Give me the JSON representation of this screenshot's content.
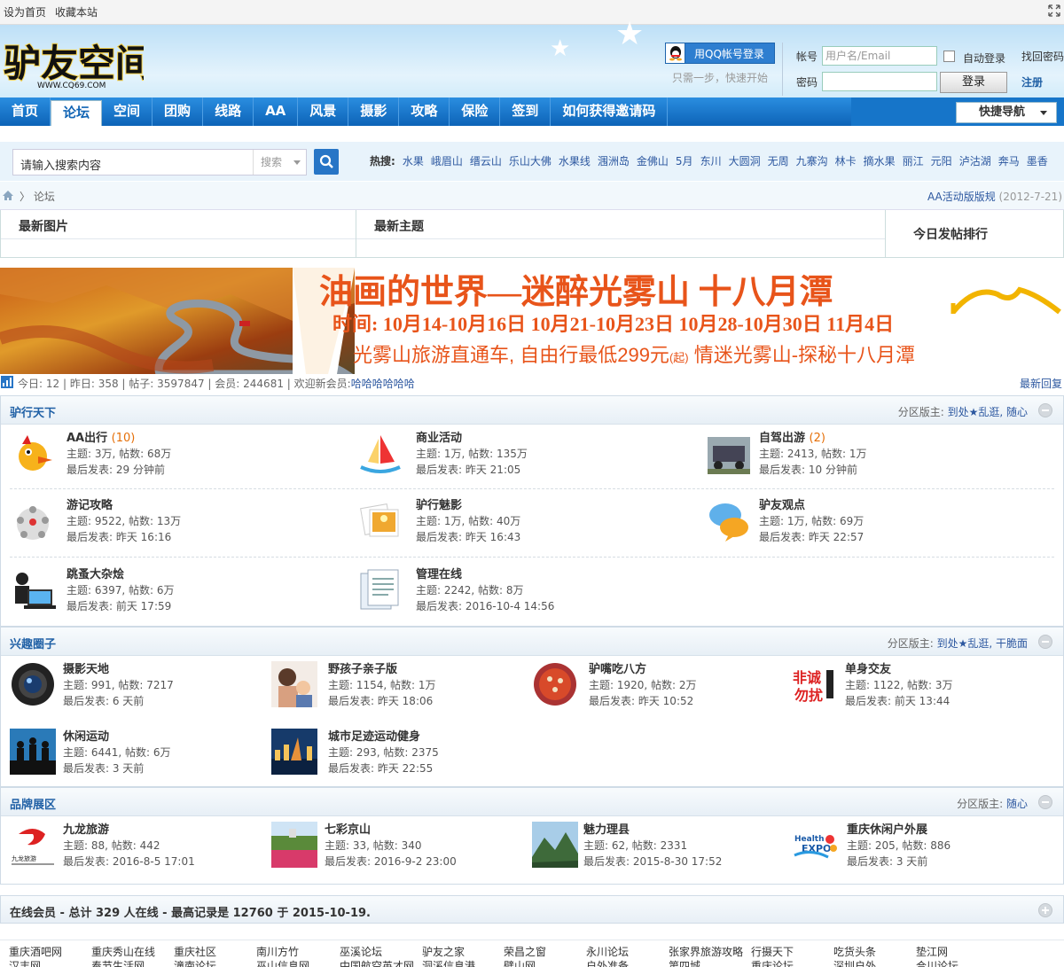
{
  "topbar": {
    "set_home": "设为首页",
    "favorite": "收藏本站"
  },
  "header": {
    "logo_text": "驴友空间",
    "logo_url": "WWW.CQ69.COM",
    "qq_login": "用QQ帐号登录",
    "qq_hint": "只需一步，快速开始",
    "account_label": "帐号",
    "username_placeholder": "用户名/Email",
    "password_label": "密码",
    "auto_login": "自动登录",
    "find_password": "找回密码",
    "login_button": "登录",
    "register": "注册"
  },
  "nav": {
    "items": [
      "首页",
      "论坛",
      "空间",
      "团购",
      "线路",
      "AA",
      "风景",
      "摄影",
      "攻略",
      "保险",
      "签到",
      "如何获得邀请码"
    ],
    "active_index": 1,
    "quick_nav": "快捷导航"
  },
  "search": {
    "placeholder": "请输入搜索内容",
    "type": "搜索",
    "hot_label": "热搜:",
    "hot": [
      "水果",
      "峨眉山",
      "缙云山",
      "乐山大佛",
      "水果线",
      "涠洲岛",
      "金佛山",
      "5月",
      "东川",
      "大圆洞",
      "无周",
      "九寨沟",
      "林卡",
      "摘水果",
      "丽江",
      "元阳",
      "泸沽湖",
      "奔马",
      "墨香"
    ]
  },
  "breadcrumb": {
    "current": "论坛",
    "notice": "AA活动版版规",
    "notice_date": "(2012-7-21)"
  },
  "latest": {
    "images": "最新图片",
    "topics": "最新主题",
    "ranking": "今日发帖排行"
  },
  "banner": {
    "title": "油画的世界—迷醉光雾山 十八月潭",
    "time": "时间: 10月14-10月16日 10月21-10月23日 10月28-10月30日 11月4日",
    "line3a": "光雾山旅游直通车, 自由行最低299元",
    "line3b": "(起)",
    "line3c": " 情迷光雾山-探秘十八月潭"
  },
  "stats": {
    "today_label": "今日:",
    "today": "12",
    "yesterday_label": "昨日:",
    "yesterday": "358",
    "posts_label": "帖子:",
    "posts": "3597847",
    "members_label": "会员:",
    "members": "244681",
    "welcome": "欢迎新会员:",
    "new_member": "哈哈哈哈哈哈",
    "latest_reply": "最新回复"
  },
  "colors": {
    "nav": "#1675c9",
    "link": "#2d58a0",
    "section_title": "#2161a6",
    "count": "#e56f08",
    "banner_text": "#e8541a"
  },
  "sections": [
    {
      "title": "驴行天下",
      "mod_label": "分区版主:",
      "mods": "到处★乱逛, 随心",
      "forums": [
        {
          "name": "AA出行",
          "count": "(10)",
          "stats": "主题: 3万, 帖数: 68万",
          "last": "最后发表: 29 分钟前",
          "icon": "bird-icon"
        },
        {
          "name": "商业活动",
          "count": "",
          "stats": "主题: 1万, 帖数: 135万",
          "last": "最后发表: 昨天 21:05",
          "icon": "sailboat-icon"
        },
        {
          "name": "自驾出游",
          "count": "(2)",
          "stats": "主题: 2413, 帖数: 1万",
          "last": "最后发表: 10 分钟前",
          "icon": "car-icon"
        },
        {
          "name": "游记攻略",
          "count": "",
          "stats": "主题: 9522, 帖数: 13万",
          "last": "最后发表: 昨天 16:16",
          "icon": "people-circle-icon"
        },
        {
          "name": "驴行魅影",
          "count": "",
          "stats": "主题: 1万, 帖数: 40万",
          "last": "最后发表: 昨天 16:43",
          "icon": "photos-icon"
        },
        {
          "name": "驴友观点",
          "count": "",
          "stats": "主题: 1万, 帖数: 69万",
          "last": "最后发表: 昨天 22:57",
          "icon": "chat-bubbles-icon"
        },
        {
          "name": "跳蚤大杂烩",
          "count": "",
          "stats": "主题: 6397, 帖数: 6万",
          "last": "最后发表: 前天 17:59",
          "icon": "laptop-user-icon"
        },
        {
          "name": "管理在线",
          "count": "",
          "stats": "主题: 2242, 帖数: 8万",
          "last": "最后发表: 2016-10-4 14:56",
          "icon": "documents-icon"
        }
      ]
    },
    {
      "title": "兴趣圈子",
      "mod_label": "分区版主:",
      "mods": "到处★乱逛, 干脆面",
      "forums": [
        {
          "name": "摄影天地",
          "count": "",
          "stats": "主题: 991, 帖数: 7217",
          "last": "最后发表: 6 天前",
          "icon": "camera-lens-icon"
        },
        {
          "name": "野孩子亲子版",
          "count": "",
          "stats": "主题: 1154, 帖数: 1万",
          "last": "最后发表: 昨天 18:06",
          "icon": "parent-child-icon"
        },
        {
          "name": "驴嘴吃八方",
          "count": "",
          "stats": "主题: 1920, 帖数: 2万",
          "last": "最后发表: 昨天 10:52",
          "icon": "hotpot-icon"
        },
        {
          "name": "单身交友",
          "count": "",
          "stats": "主题: 1122, 帖数: 3万",
          "last": "最后发表: 前天 13:44",
          "icon": "singles-icon"
        },
        {
          "name": "休闲运动",
          "count": "",
          "stats": "主题: 6441, 帖数: 6万",
          "last": "最后发表: 3 天前",
          "icon": "silhouettes-icon"
        },
        {
          "name": "城市足迹运动健身",
          "count": "",
          "stats": "主题: 293, 帖数: 2375",
          "last": "最后发表: 昨天 22:55",
          "icon": "city-night-icon"
        }
      ]
    },
    {
      "title": "品牌展区",
      "mod_label": "分区版主:",
      "mods": "随心",
      "forums": [
        {
          "name": "九龙旅游",
          "count": "",
          "stats": "主题: 88, 帖数: 442",
          "last": "最后发表: 2016-8-5 17:01",
          "icon": "dragon-logo-icon"
        },
        {
          "name": "七彩京山",
          "count": "",
          "stats": "主题: 33, 帖数: 340",
          "last": "最后发表: 2016-9-2 23:00",
          "icon": "flower-field-icon"
        },
        {
          "name": "魅力理县",
          "count": "",
          "stats": "主题: 62, 帖数: 2331",
          "last": "最后发表: 2015-8-30 17:52",
          "icon": "mountain-icon"
        },
        {
          "name": "重庆休闲户外展",
          "count": "",
          "stats": "主题: 205, 帖数: 886",
          "last": "最后发表: 3 天前",
          "icon": "health-expo-icon"
        }
      ]
    }
  ],
  "online": {
    "text": "在线会员 - 总计 329 人在线 - 最高记录是 12760 于 2015-10-19."
  },
  "friend_links": {
    "row1": [
      "重庆酒吧网",
      "重庆秀山在线",
      "重庆社区",
      "南川方竹",
      "巫溪论坛",
      "驴友之家",
      "荣昌之窗",
      "永川论坛",
      "张家界旅游攻略",
      "行摄天下",
      "吃货头条",
      "垫江网"
    ],
    "row2": [
      "汉丰网",
      "奉节生活网",
      "潼南论坛",
      "巫山信息网",
      "中国航空英才网",
      "洞溪信息港",
      "壁山网",
      "户外准备",
      "第四城",
      "重庆论坛",
      "深圳户外",
      "合川论坛"
    ]
  }
}
